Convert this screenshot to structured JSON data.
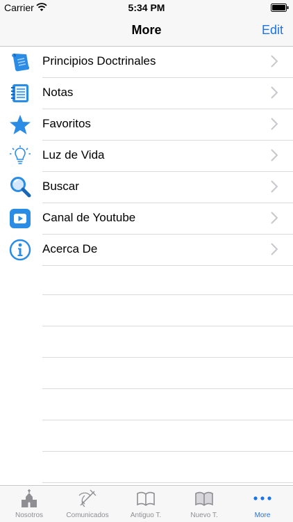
{
  "status": {
    "carrier": "Carrier",
    "time": "5:34 PM"
  },
  "nav": {
    "title": "More",
    "edit": "Edit"
  },
  "accent": "#1a73e8",
  "items": [
    {
      "label": "Principios Doctrinales",
      "icon": "scroll-icon"
    },
    {
      "label": "Notas",
      "icon": "notepad-icon"
    },
    {
      "label": "Favoritos",
      "icon": "star-icon"
    },
    {
      "label": "Luz de Vida",
      "icon": "lightbulb-icon"
    },
    {
      "label": "Buscar",
      "icon": "magnifier-icon"
    },
    {
      "label": "Canal de Youtube",
      "icon": "youtube-icon"
    },
    {
      "label": "Acerca De",
      "icon": "info-icon"
    }
  ],
  "tabs": [
    {
      "label": "Nosotros",
      "icon": "church-icon"
    },
    {
      "label": "Comunicados",
      "icon": "megaphone-icon"
    },
    {
      "label": "Antiguo T.",
      "icon": "book-open-icon"
    },
    {
      "label": "Nuevo T.",
      "icon": "book-open-icon"
    },
    {
      "label": "More",
      "icon": "more-dots-icon"
    }
  ]
}
